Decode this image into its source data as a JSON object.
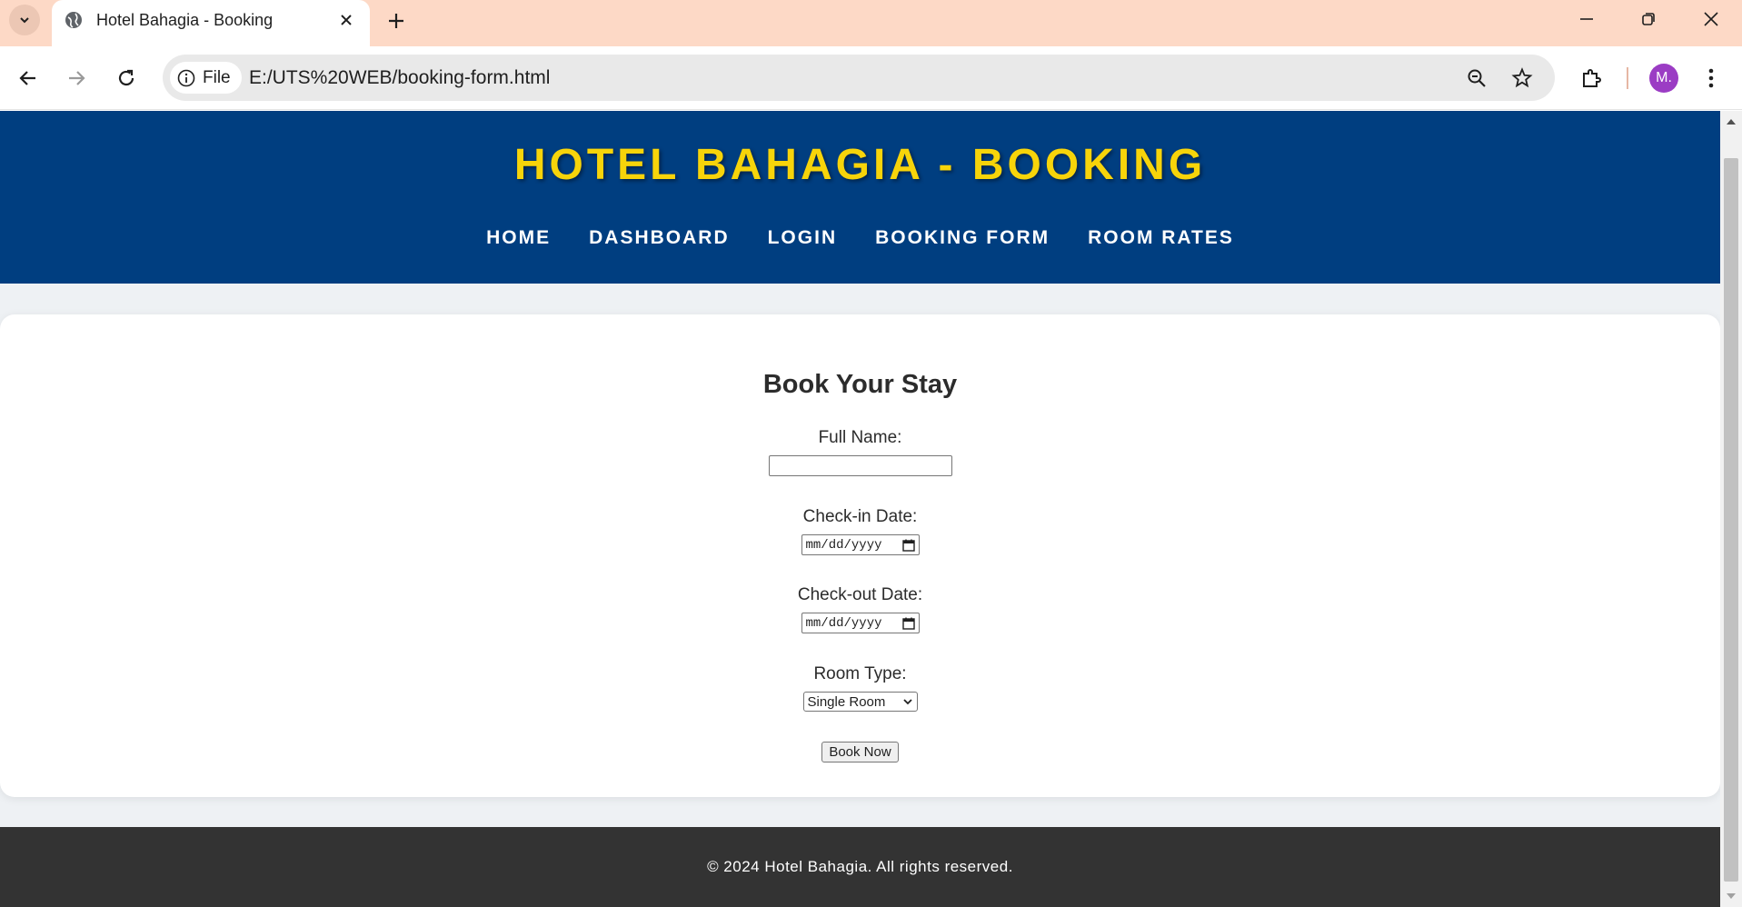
{
  "browser": {
    "tab_title": "Hotel Bahagia - Booking",
    "chip_label": "File",
    "url": "E:/UTS%20WEB/booking-form.html",
    "avatar_initial": "M."
  },
  "site": {
    "title": "HOTEL BAHAGIA - BOOKING",
    "nav": [
      "HOME",
      "DASHBOARD",
      "LOGIN",
      "BOOKING FORM",
      "ROOM RATES"
    ]
  },
  "form": {
    "title": "Book Your Stay",
    "full_name_label": "Full Name:",
    "full_name_value": "",
    "checkin_label": "Check-in Date:",
    "checkin_placeholder": "mm/dd/yyyy",
    "checkout_label": "Check-out Date:",
    "checkout_placeholder": "mm/dd/yyyy",
    "room_type_label": "Room Type:",
    "room_type_selected": "Single Room",
    "submit_label": "Book Now"
  },
  "footer": {
    "text": "© 2024 Hotel Bahagia. All rights reserved."
  },
  "colors": {
    "header_bg": "#003e80",
    "title_color": "#f7d40a",
    "footer_bg": "#333333",
    "page_bg": "#eef1f4",
    "tabstrip_bg": "#fdd9c6"
  }
}
